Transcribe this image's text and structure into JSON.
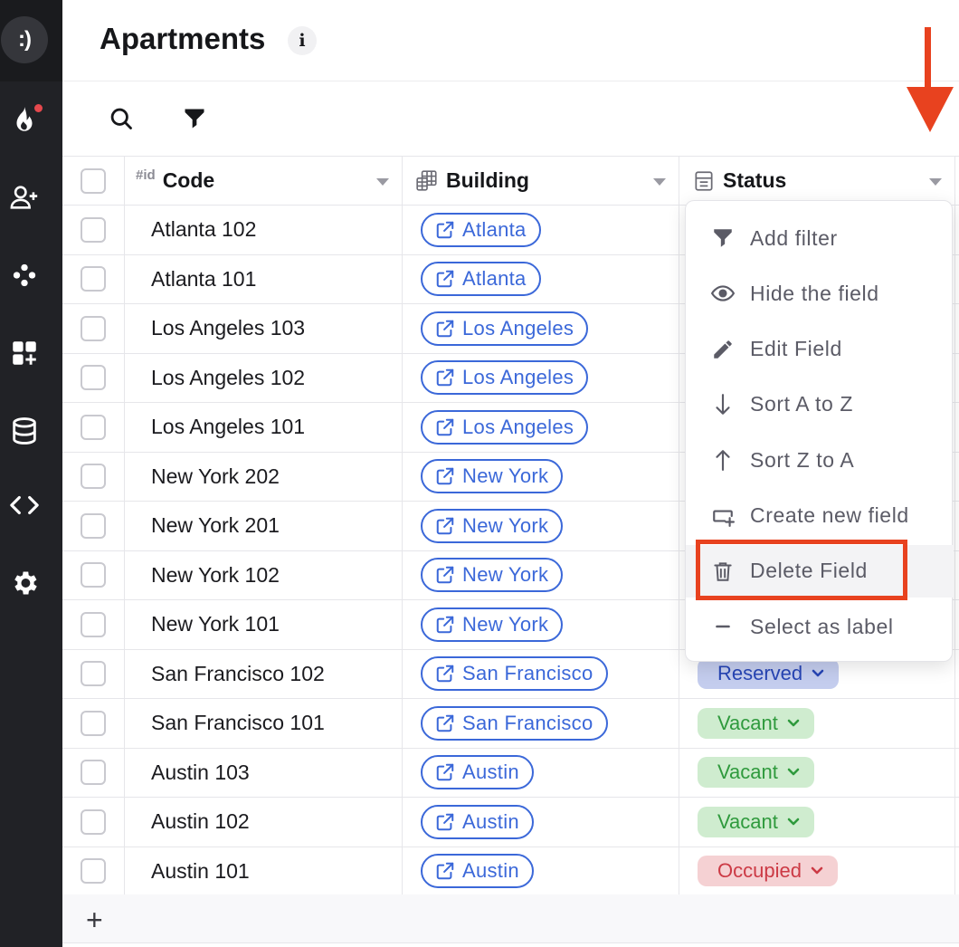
{
  "app": {
    "logo_text": ":)"
  },
  "header": {
    "title": "Apartments",
    "info_glyph": "i"
  },
  "sidebar": {
    "items": [
      {
        "name": "fire-icon",
        "notification": true
      },
      {
        "name": "add-user-icon"
      },
      {
        "name": "graph-icon"
      },
      {
        "name": "add-widget-icon"
      },
      {
        "name": "database-icon"
      },
      {
        "name": "code-icon"
      },
      {
        "name": "gear-icon"
      }
    ]
  },
  "toolbar": {
    "search_icon": "search-icon",
    "filter_icon": "filter-icon"
  },
  "table": {
    "columns": [
      {
        "prefix": "#id",
        "label": "Code"
      },
      {
        "label": "Building"
      },
      {
        "label": "Status"
      }
    ],
    "rows": [
      {
        "code": "Atlanta 102",
        "building": "Atlanta",
        "status": ""
      },
      {
        "code": "Atlanta 101",
        "building": "Atlanta",
        "status": ""
      },
      {
        "code": "Los Angeles 103",
        "building": "Los Angeles",
        "status": ""
      },
      {
        "code": "Los Angeles 102",
        "building": "Los Angeles",
        "status": ""
      },
      {
        "code": "Los Angeles 101",
        "building": "Los Angeles",
        "status": ""
      },
      {
        "code": "New York 202",
        "building": "New York",
        "status": ""
      },
      {
        "code": "New York 201",
        "building": "New York",
        "status": ""
      },
      {
        "code": "New York 102",
        "building": "New York",
        "status": ""
      },
      {
        "code": "New York 101",
        "building": "New York",
        "status": ""
      },
      {
        "code": "San Francisco 102",
        "building": "San Francisco",
        "status": "Reserved"
      },
      {
        "code": "San Francisco 101",
        "building": "San Francisco",
        "status": "Vacant"
      },
      {
        "code": "Austin 103",
        "building": "Austin",
        "status": "Vacant"
      },
      {
        "code": "Austin 102",
        "building": "Austin",
        "status": "Vacant"
      },
      {
        "code": "Austin 101",
        "building": "Austin",
        "status": "Occupied"
      }
    ],
    "add_row_glyph": "+"
  },
  "column_menu": {
    "items": [
      {
        "icon": "filter-icon",
        "label": "Add filter"
      },
      {
        "icon": "eye-icon",
        "label": "Hide the field"
      },
      {
        "icon": "pencil-icon",
        "label": "Edit Field"
      },
      {
        "icon": "arrow-down-icon",
        "label": "Sort A to Z"
      },
      {
        "icon": "arrow-up-icon",
        "label": "Sort Z to A"
      },
      {
        "icon": "add-field-icon",
        "label": "Create new field"
      },
      {
        "icon": "trash-icon",
        "label": "Delete Field",
        "highlighted": true
      },
      {
        "icon": "minus-icon",
        "label": "Select as label"
      }
    ]
  },
  "colors": {
    "accent_link": "#3b68d9",
    "annotation": "#e8421f",
    "reserved": "#2745b5",
    "vacant": "#2f9a3d",
    "occupied": "#cc3a45"
  }
}
